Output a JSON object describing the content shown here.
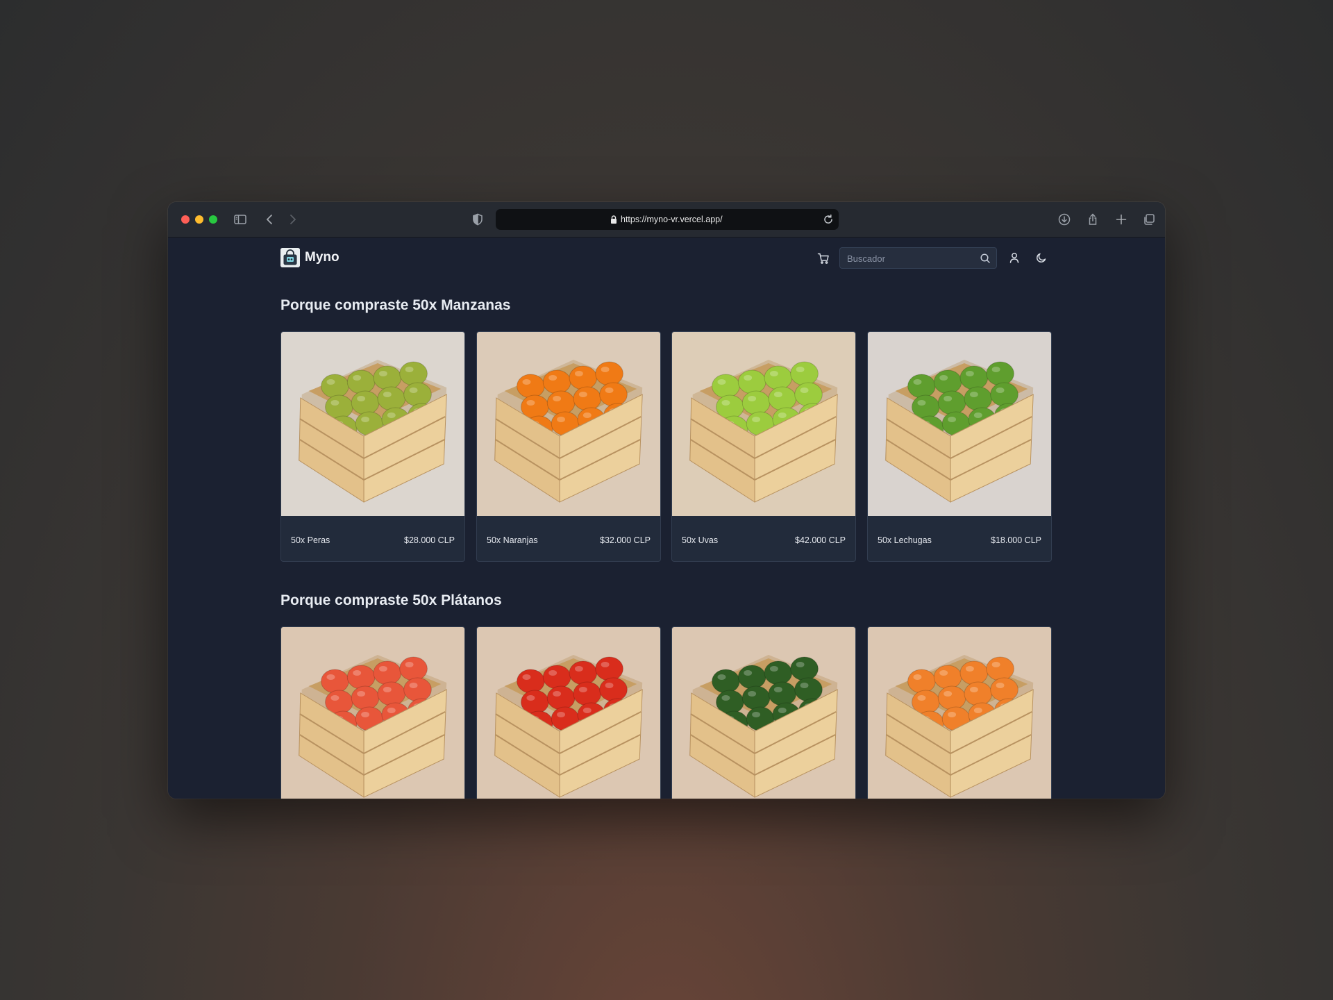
{
  "browser": {
    "url": "https://myno-vr.vercel.app/"
  },
  "nav": {
    "brand": "Myno",
    "search_placeholder": "Buscador"
  },
  "sections": [
    {
      "title": "Porque compraste 50x Manzanas",
      "products": [
        {
          "name": "50x Peras",
          "price": "$28.000 CLP",
          "image": "pears-crate",
          "color": "#9bb03a"
        },
        {
          "name": "50x Naranjas",
          "price": "$32.000 CLP",
          "image": "oranges-crate",
          "color": "#f07a15"
        },
        {
          "name": "50x Uvas",
          "price": "$42.000 CLP",
          "image": "grapes-crate",
          "color": "#9ccc3e"
        },
        {
          "name": "50x Lechugas",
          "price": "$18.000 CLP",
          "image": "lettuce-crate",
          "color": "#5f9e2e"
        }
      ]
    },
    {
      "title": "Porque compraste 50x Plátanos",
      "products": [
        {
          "name": "",
          "price": "",
          "image": "mangoes-crate",
          "color": "#e8563a"
        },
        {
          "name": "",
          "price": "",
          "image": "tomatoes-crate",
          "color": "#d92d1c"
        },
        {
          "name": "",
          "price": "",
          "image": "cucumbers-crate",
          "color": "#2f5e24"
        },
        {
          "name": "",
          "price": "",
          "image": "carrots-crate",
          "color": "#f0802a"
        }
      ]
    }
  ],
  "colors": {
    "page_bg": "#1b2131",
    "card_bg": "#222b3b",
    "card_border": "#323d50",
    "text": "#e6e9ef"
  }
}
